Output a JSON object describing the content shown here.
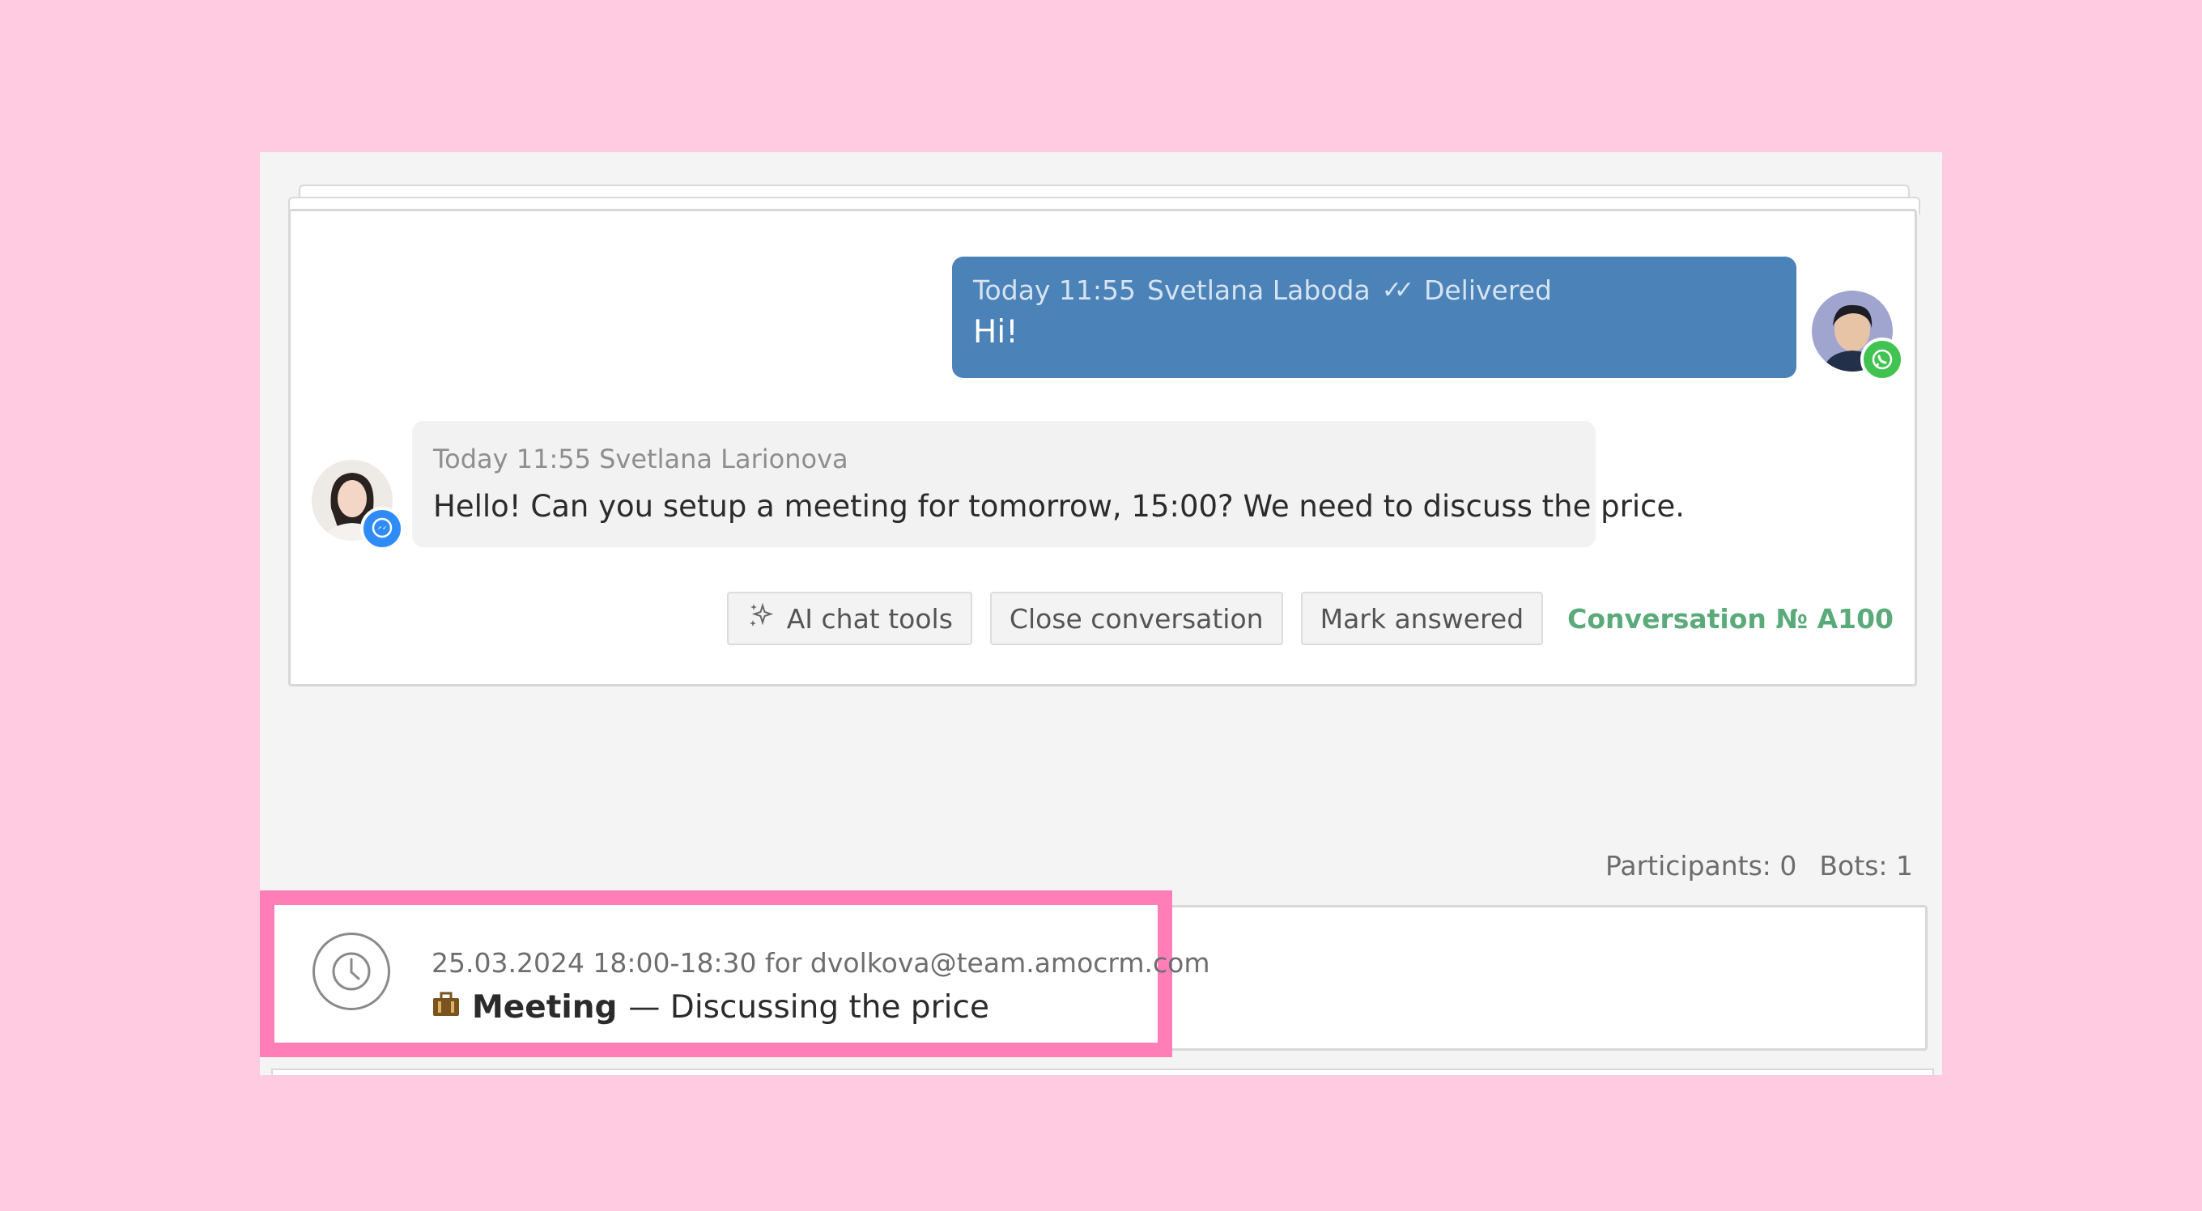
{
  "outgoing_message": {
    "time": "Today 11:55",
    "author": "Svetlana Laboda",
    "status": "Delivered",
    "text": "Hi!",
    "channel_icon": "whatsapp-icon",
    "bubble_color": "#4b82b8"
  },
  "incoming_message": {
    "time": "Today 11:55",
    "author": "Svetlana Larionova",
    "text": "Hello! Can you setup a meeting for tomorrow,  15:00? We need to discuss the price.",
    "channel_icon": "messenger-icon"
  },
  "actions": {
    "ai_tools_label": "AI chat tools",
    "close_label": "Close conversation",
    "mark_answered_label": "Mark answered",
    "conversation_number": "Conversation № A100"
  },
  "footer": {
    "participants": "Participants: 0",
    "bots": "Bots: 1"
  },
  "task": {
    "meta": "25.03.2024 18:00-18:30 for dvolkova@team.amocrm.com",
    "type": "Meeting",
    "description": "— Discussing the price",
    "icon": "briefcase-icon"
  },
  "colors": {
    "background": "#FFCBE1",
    "highlight": "#FF7EB8",
    "conversation_number": "#5aaa7a"
  }
}
